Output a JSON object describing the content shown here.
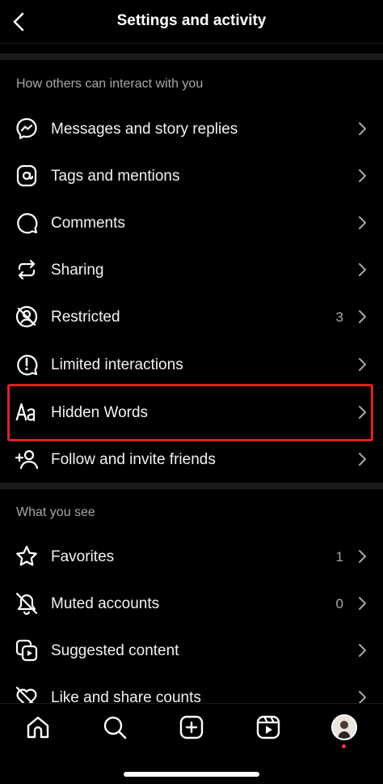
{
  "header": {
    "title": "Settings and activity"
  },
  "sections": [
    {
      "title": "How others can interact with you",
      "items": [
        {
          "label": "Messages and story replies",
          "icon": "messenger-icon",
          "count": ""
        },
        {
          "label": "Tags and mentions",
          "icon": "at-sign-icon",
          "count": ""
        },
        {
          "label": "Comments",
          "icon": "comment-icon",
          "count": ""
        },
        {
          "label": "Sharing",
          "icon": "share-arrows-icon",
          "count": ""
        },
        {
          "label": "Restricted",
          "icon": "restricted-icon",
          "count": "3"
        },
        {
          "label": "Limited interactions",
          "icon": "alert-circle-icon",
          "count": ""
        },
        {
          "label": "Hidden Words",
          "icon": "text-aa-icon",
          "count": "",
          "highlighted": true
        },
        {
          "label": "Follow and invite friends",
          "icon": "add-person-icon",
          "count": ""
        }
      ]
    },
    {
      "title": "What you see",
      "items": [
        {
          "label": "Favorites",
          "icon": "star-icon",
          "count": "1"
        },
        {
          "label": "Muted accounts",
          "icon": "bell-off-icon",
          "count": "0"
        },
        {
          "label": "Suggested content",
          "icon": "suggested-content-icon",
          "count": ""
        },
        {
          "label": "Like and share counts",
          "icon": "heart-off-icon",
          "count": ""
        }
      ]
    }
  ],
  "tabbar": [
    "home-icon",
    "search-icon",
    "create-icon",
    "reels-icon",
    "profile-avatar"
  ],
  "colors": {
    "background": "#000000",
    "highlight": "#e0221b",
    "secondary_text": "#a8a8a8",
    "notification_dot": "#ff3040"
  }
}
